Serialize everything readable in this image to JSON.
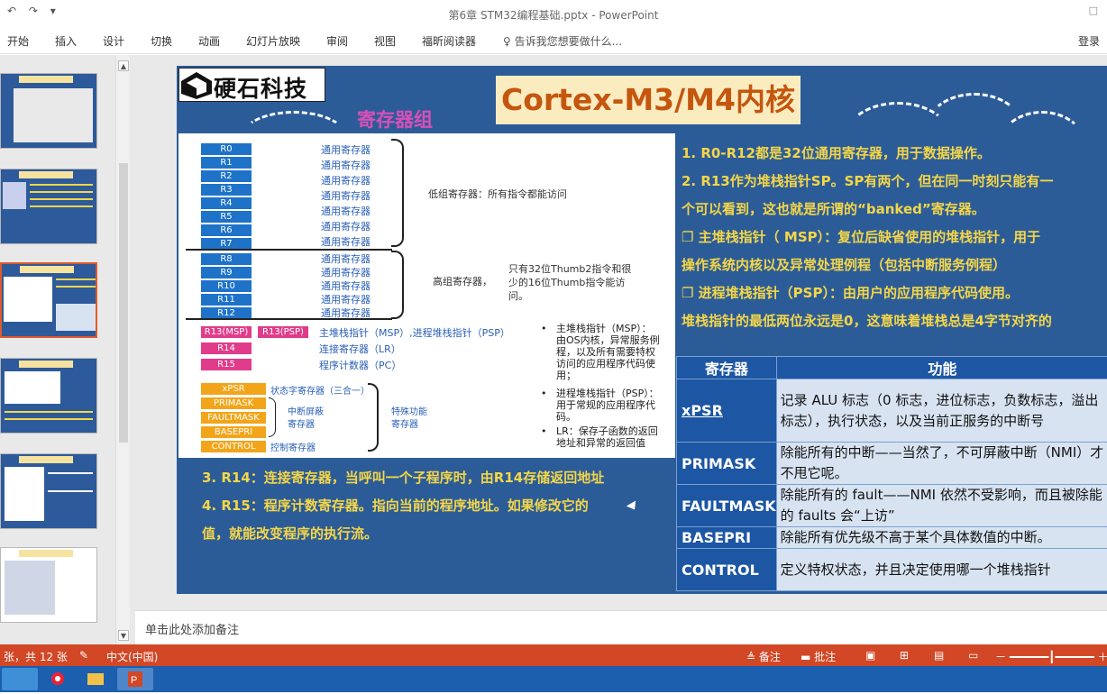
{
  "titlebar": {
    "title": "第6章 STM32编程基础.pptx - PowerPoint",
    "quick_access": [
      "↶",
      "↷",
      "▾"
    ],
    "window_controls": "□"
  },
  "ribbon": {
    "tabs": [
      "开始",
      "插入",
      "设计",
      "切换",
      "动画",
      "幻灯片放映",
      "审阅",
      "视图",
      "福昕阅读器"
    ],
    "tell_me": "告诉我您想要做什么...",
    "login": "登录"
  },
  "slide": {
    "logo_text": "硬石科技",
    "title": "Cortex-M3/M4内核",
    "reg_group_title": "寄存器组",
    "low_regs": [
      "R0",
      "R1",
      "R2",
      "R3",
      "R4",
      "R5",
      "R6",
      "R7"
    ],
    "high_regs": [
      "R8",
      "R9",
      "R10",
      "R11",
      "R12"
    ],
    "general_label": "通用寄存器",
    "low_note": "低组寄存器：所有指令都能访问",
    "high_note_label": "高组寄存器，",
    "high_note": [
      "只有32位Thumb2指令和很",
      "少的16位Thumb指令能访",
      "问。"
    ],
    "r13_msp": "R13(MSP)",
    "r13_psp": "R13(PSP)",
    "r13_label": "主堆栈指针（MSP）,进程堆栈指针（PSP）",
    "r14": "R14",
    "r14_label": "连接寄存器（LR）",
    "r15": "R15",
    "r15_label": "程序计数器（PC）",
    "special_regs": [
      "xPSR",
      "PRIMASK",
      "FAULTMASK",
      "BASEPRI",
      "CONTROL"
    ],
    "xpsr_label": "状态字寄存器（三合一）",
    "mask_label": [
      "中断屏蔽",
      "寄存器"
    ],
    "special_func_label": [
      "特殊功能",
      "寄存器"
    ],
    "control_label": "控制寄存器",
    "bullets": [
      [
        "主堆栈指针（MSP）：",
        "由OS内核，异常服务例",
        "程，以及所有需要特权",
        "访问的应用程序代码使",
        "用；"
      ],
      [
        "进程堆栈指针（PSP）：",
        "用于常规的应用程序代",
        "码。"
      ],
      [
        "LR：保存子函数的返回",
        "地址和异常的返回值"
      ]
    ],
    "right_lines": [
      "1.   R0-R12都是32位通用寄存器，用于数据操作。",
      "2.   R13作为堆栈指针SP。SP有两个，但在同一时刻只能有一",
      "       个可以看到，这也就是所谓的“banked”寄存器。",
      "❐   主堆栈指针（ MSP）：复位后缺省使用的堆栈指针，用于",
      "       操作系统内核以及异常处理例程（包括中断服务例程）",
      "❐   进程堆栈指针（PSP）：由用户的应用程序代码使用。",
      "堆栈指针的最低两位永远是0，这意味着堆栈总是4字节对齐的"
    ],
    "bottom_lines": [
      "3.   R14：连接寄存器，当呼叫一个子程序时，由R14存储返回地址",
      "4.   R15：程序计数寄存器。指向当前的程序地址。如果修改它的",
      "       值，就能改变程序的执行流。"
    ],
    "table": {
      "headers": [
        "寄存器",
        "功能"
      ],
      "rows": [
        {
          "name": "xPSR",
          "desc": "记录 ALU 标志（0 标志，进位标志，负数标志，溢出标志），执行状态，以及当前正服务的中断号"
        },
        {
          "name": "PRIMASK",
          "desc": "除能所有的中断——当然了，不可屏蔽中断（NMI）才不甩它呢。"
        },
        {
          "name": "FAULTMASK",
          "desc": "除能所有的 fault——NMI 依然不受影响，而且被除能的 faults 会“上访”"
        },
        {
          "name": "BASEPRI",
          "desc": "除能所有优先级不高于某个具体数值的中断。"
        },
        {
          "name": "CONTROL",
          "desc": "定义特权状态，并且决定使用哪一个堆栈指针"
        }
      ]
    }
  },
  "notes_placeholder": "单击此处添加备注",
  "status": {
    "slide_info": "张，共 12 张",
    "language": "中文(中国)",
    "notes_btn": "备注",
    "comments_btn": "批注"
  },
  "colors": {
    "slide_bg": "#2c5c98",
    "accent_yellow": "#f4d648",
    "title_orange": "#c4560f",
    "status_red": "#d24726",
    "taskbar_blue": "#1b5fae"
  }
}
